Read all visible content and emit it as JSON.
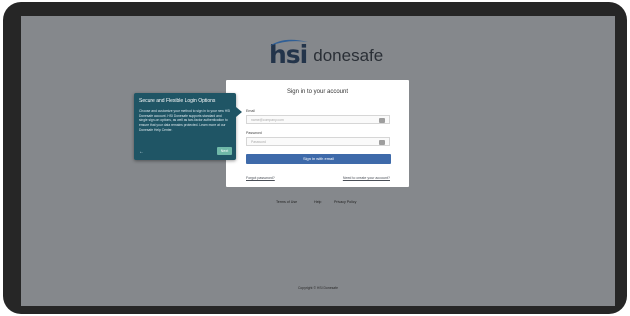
{
  "logo": {
    "mark": "hsi",
    "product": "donesafe"
  },
  "login": {
    "title": "Sign in to your account",
    "email_label": "Email",
    "email_placeholder": "name@company.com",
    "password_label": "Password",
    "password_placeholder": "Password",
    "submit_label": "Sign in with email",
    "forgot_link": "Forgot password?",
    "need_account_link": "Need to create your account?"
  },
  "tooltip": {
    "title": "Secure and Flexible Login Options",
    "body": "Choose and customize your method to sign in to your new HSI Donesafe account. HSI Donesafe supports standard and single sign-on options, as well as two-factor authentication to ensure that your data remains protected. Learn more at our Donesafe Help Center.",
    "back_label": "←",
    "next_label": "Next"
  },
  "footer": {
    "links": [
      "Terms of Use",
      "Help",
      "Privacy Policy"
    ],
    "copyright": "Copyright © HSI Donesafe"
  },
  "colors": {
    "device_frame": "#262626",
    "overlay_background": "#85888c",
    "primary_button": "#3e6aaa",
    "tooltip_background": "#1f5565",
    "tooltip_next": "#6fb8a8"
  }
}
